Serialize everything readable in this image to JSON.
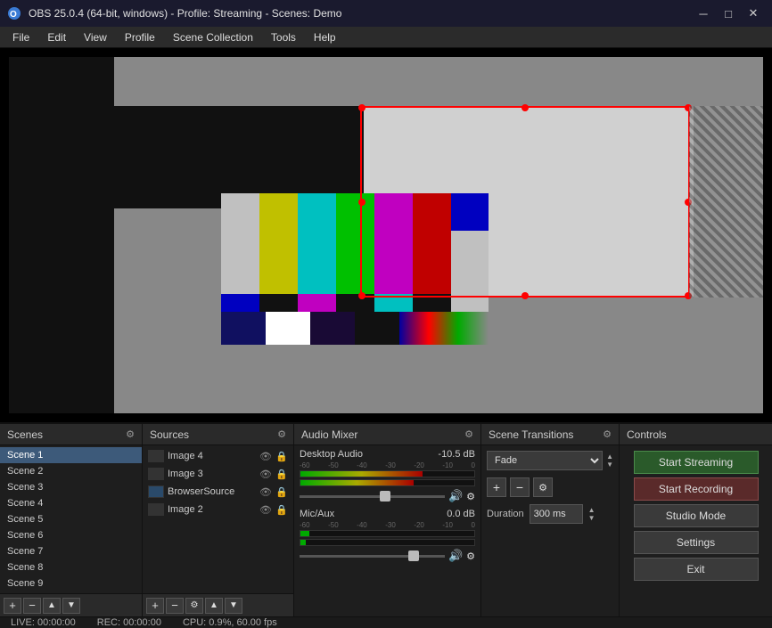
{
  "titlebar": {
    "title": "OBS 25.0.4 (64-bit, windows) - Profile: Streaming - Scenes: Demo",
    "min_btn": "─",
    "max_btn": "□",
    "close_btn": "✕"
  },
  "menubar": {
    "items": [
      "File",
      "Edit",
      "View",
      "Profile",
      "Scene Collection",
      "Tools",
      "Help"
    ]
  },
  "panels": {
    "scenes": {
      "title": "Scenes",
      "items": [
        {
          "name": "Scene 1",
          "active": true
        },
        {
          "name": "Scene 2",
          "active": false
        },
        {
          "name": "Scene 3",
          "active": false
        },
        {
          "name": "Scene 4",
          "active": false
        },
        {
          "name": "Scene 5",
          "active": false
        },
        {
          "name": "Scene 6",
          "active": false
        },
        {
          "name": "Scene 7",
          "active": false
        },
        {
          "name": "Scene 8",
          "active": false
        },
        {
          "name": "Scene 9",
          "active": false
        }
      ]
    },
    "sources": {
      "title": "Sources",
      "items": [
        {
          "name": "Image 4"
        },
        {
          "name": "Image 3"
        },
        {
          "name": "BrowserSource"
        },
        {
          "name": "Image 2"
        }
      ]
    },
    "audio_mixer": {
      "title": "Audio Mixer",
      "tracks": [
        {
          "name": "Desktop Audio",
          "db": "-10.5 dB",
          "meter_pct": 70
        },
        {
          "name": "Mic/Aux",
          "db": "0.0 dB",
          "meter_pct": 10
        }
      ]
    },
    "scene_transitions": {
      "title": "Scene Transitions",
      "selected": "Fade",
      "duration_label": "Duration",
      "duration_value": "300 ms"
    },
    "controls": {
      "title": "Controls",
      "buttons": [
        {
          "label": "Start Streaming",
          "class": "start-streaming"
        },
        {
          "label": "Start Recording",
          "class": "start-recording"
        },
        {
          "label": "Studio Mode",
          "class": ""
        },
        {
          "label": "Settings",
          "class": ""
        },
        {
          "label": "Exit",
          "class": ""
        }
      ]
    }
  },
  "statusbar": {
    "live": "LIVE: 00:00:00",
    "rec": "REC: 00:00:00",
    "cpu": "CPU: 0.9%, 60.00 fps"
  }
}
